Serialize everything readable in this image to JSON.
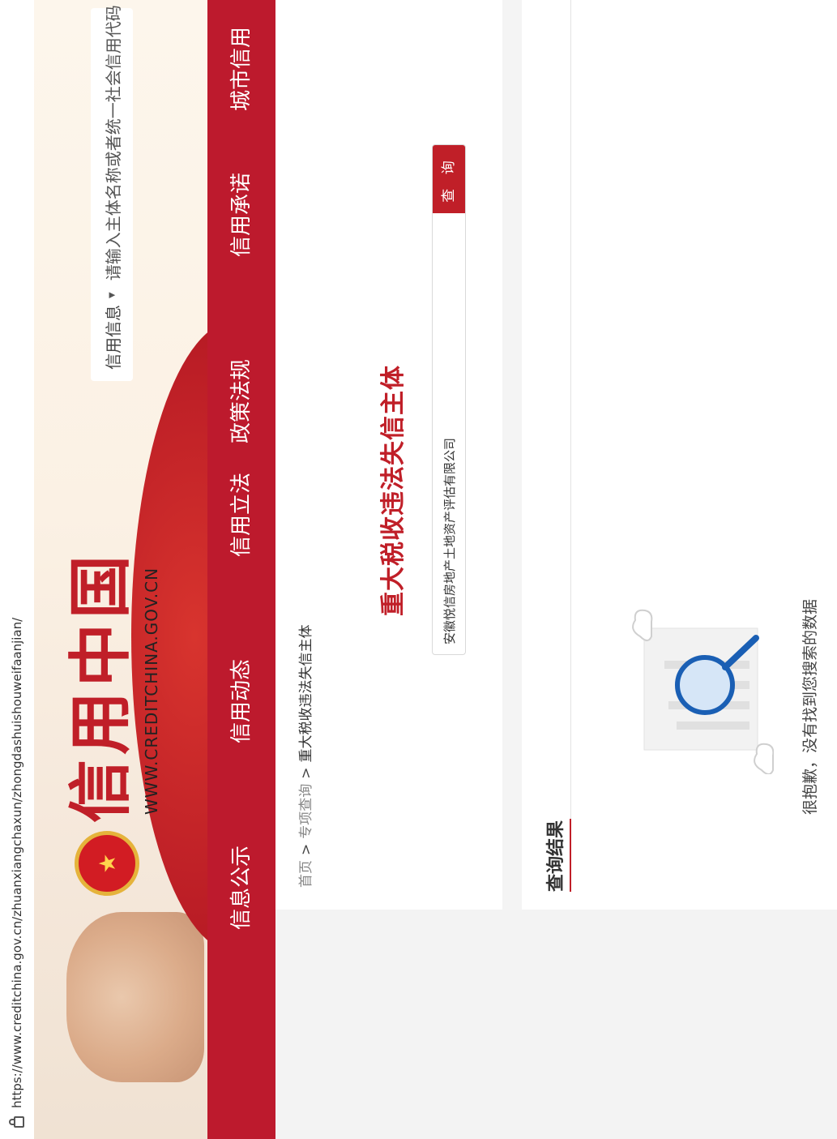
{
  "browser": {
    "url": "https://www.creditchina.gov.cn/zhuanxiangchaxun/zhongdashuishouweifaanjian/"
  },
  "header": {
    "site_title": "信用中国",
    "site_url_text": "WWW.CREDITCHINA.GOV.CN",
    "search_category": "信用信息",
    "search_placeholder": "请输入主体名称或者统一社会信用代码"
  },
  "nav": {
    "items": [
      {
        "label": "信息公示"
      },
      {
        "label": "信用动态"
      },
      {
        "label": "信用立法"
      },
      {
        "label": "政策法规"
      },
      {
        "label": "信用承诺"
      },
      {
        "label": "城市信用"
      }
    ]
  },
  "breadcrumb": {
    "home": "首页",
    "sep": ">",
    "level2": "专项查询",
    "current": "重大税收违法失信主体"
  },
  "query": {
    "title": "重大税收违法失信主体",
    "input_value": "安徽悦信房地产土地资产评估有限公司",
    "button_label": "查 询"
  },
  "results": {
    "title": "查询结果",
    "empty_message": "很抱歉，没有找到您搜索的数据"
  },
  "colors": {
    "brand_red": "#c01f28",
    "nav_red": "#bd1a2d"
  }
}
